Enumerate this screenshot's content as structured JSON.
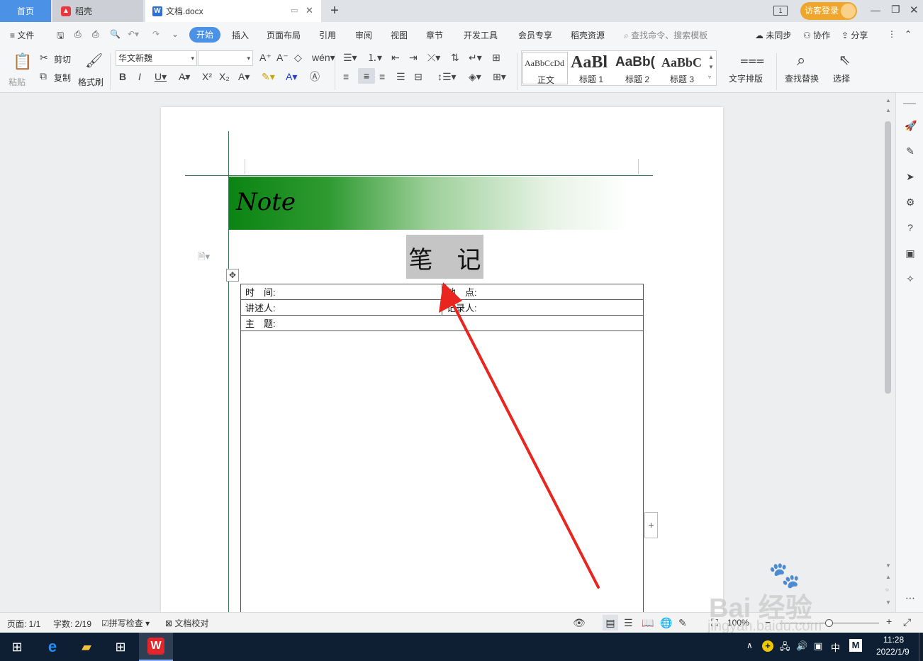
{
  "tabs": {
    "home": "首页",
    "daoke": "稻壳",
    "doc": "文档.docx",
    "new_tab": "+"
  },
  "titlebar": {
    "login": "访客登录",
    "screen_badge": "1"
  },
  "menu": {
    "file": "文件",
    "items": [
      "开始",
      "插入",
      "页面布局",
      "引用",
      "审阅",
      "视图",
      "章节",
      "开发工具",
      "会员专享",
      "稻壳资源"
    ],
    "search_placeholder": "查找命令、搜索模板",
    "sync": "未同步",
    "collab": "协作",
    "share": "分享"
  },
  "ribbon": {
    "paste": "粘贴",
    "cut": "剪切",
    "copy": "复制",
    "format_painter": "格式刷",
    "font_name": "华文新魏",
    "font_size": "",
    "styles": [
      {
        "preview": "AaBbCcDd",
        "label": "正文"
      },
      {
        "preview": "AaBl",
        "label": "标题 1"
      },
      {
        "preview": "AaBb(",
        "label": "标题 2"
      },
      {
        "preview": "AaBbC",
        "label": "标题 3"
      }
    ],
    "text_layout": "文字排版",
    "find_replace": "查找替换",
    "select": "选择"
  },
  "document": {
    "banner_text": "Note",
    "heading": "笔　记",
    "table": {
      "time": "时　间:",
      "place": "地　点:",
      "speaker": "讲述人:",
      "recorder": "记录人:",
      "topic": "主　题:"
    }
  },
  "statusbar": {
    "page": "页面: 1/1",
    "words": "字数: 2/19",
    "spell": "拼写检查",
    "proof": "文档校对",
    "zoom": "100%"
  },
  "taskbar": {
    "time": "11:28",
    "date": "2022/1/9",
    "ime": "中",
    "ime2": "M"
  },
  "watermark": {
    "brand": "Bai 经验",
    "url": "jingyan.baidu.com"
  },
  "colors": {
    "accent": "#4b91e6",
    "banner_start": "#0b8413",
    "arrow": "#e8251f",
    "login_bg": "#f0a52b"
  }
}
